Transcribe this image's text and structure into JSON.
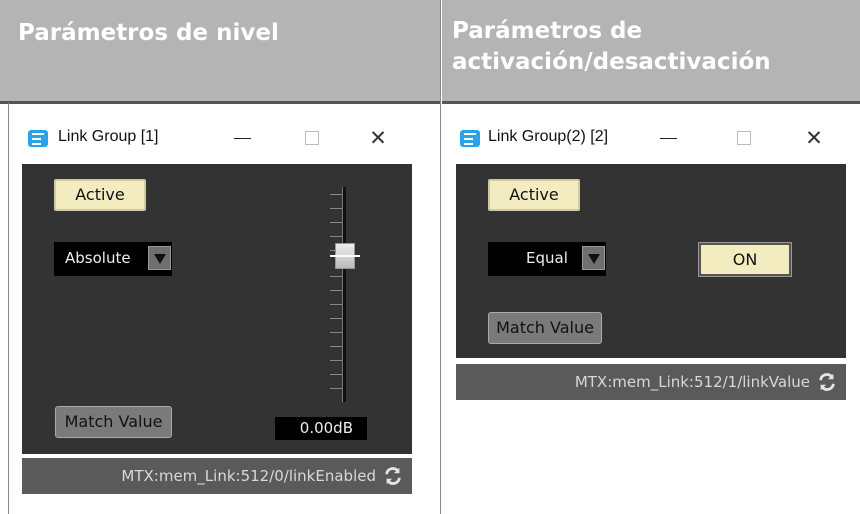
{
  "headers": {
    "level": "Parámetros de nivel",
    "onoff_line1": "Parámetros de",
    "onoff_line2": "activación/desactivación"
  },
  "window_level": {
    "title": "Link Group [1]",
    "active_label": "Active",
    "mode_value": "Absolute",
    "match_label": "Match Value",
    "fader_value": "0.00dB",
    "fader_level_fraction": 0.32,
    "status_text": "MTX:mem_Link:512/0/linkEnabled"
  },
  "window_onoff": {
    "title": "Link Group(2) [2]",
    "active_label": "Active",
    "mode_value": "Equal",
    "on_label": "ON",
    "match_label": "Match Value",
    "status_text": "MTX:mem_Link:512/1/linkValue"
  },
  "window_controls": {
    "minimize": "—",
    "close": "✕"
  },
  "colors": {
    "header_bg": "#b4b4b4",
    "panel_bg": "#333333",
    "status_bg": "#5a5a5a",
    "active_button": "#f3ecc0",
    "app_logo": "#2aa4e8"
  },
  "icons": [
    "app-logo-icon",
    "minimize-icon",
    "maximize-icon",
    "close-icon",
    "dropdown-arrow-icon",
    "refresh-icon"
  ]
}
